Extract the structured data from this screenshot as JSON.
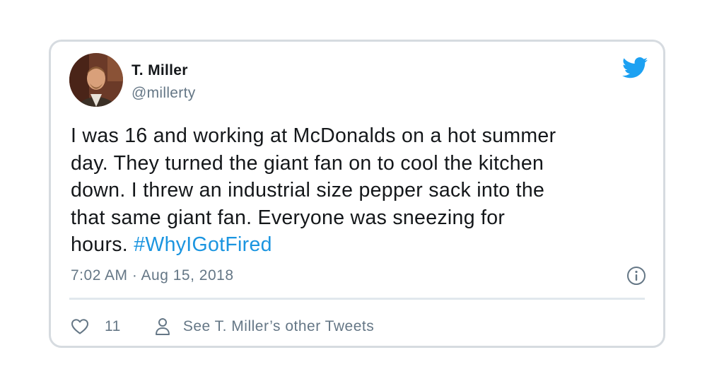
{
  "tweet": {
    "author_name": "T. Miller",
    "author_handle": "@millerty",
    "text_lines": [
      "I was 16 and working at McDonalds on a hot summer",
      "day. They turned the giant fan on to cool the kitchen",
      "down. I threw an industrial size pepper sack into the",
      "that same giant fan. Everyone was sneezing for",
      "hours."
    ],
    "hashtag": "#WhyIGotFired",
    "timestamp": "7:02 AM · Aug 15, 2018",
    "like_count": "11",
    "profile_link_label": "See T. Miller’s other Tweets"
  },
  "icons": {
    "brand": "twitter-bird-icon",
    "info": "info-icon",
    "like": "heart-icon",
    "profile": "person-icon"
  },
  "colors": {
    "text": "#14171a",
    "secondary": "#657786",
    "accent": "#1b95e0",
    "twitter_blue": "#1da1f2",
    "border": "#d6dbe0"
  }
}
